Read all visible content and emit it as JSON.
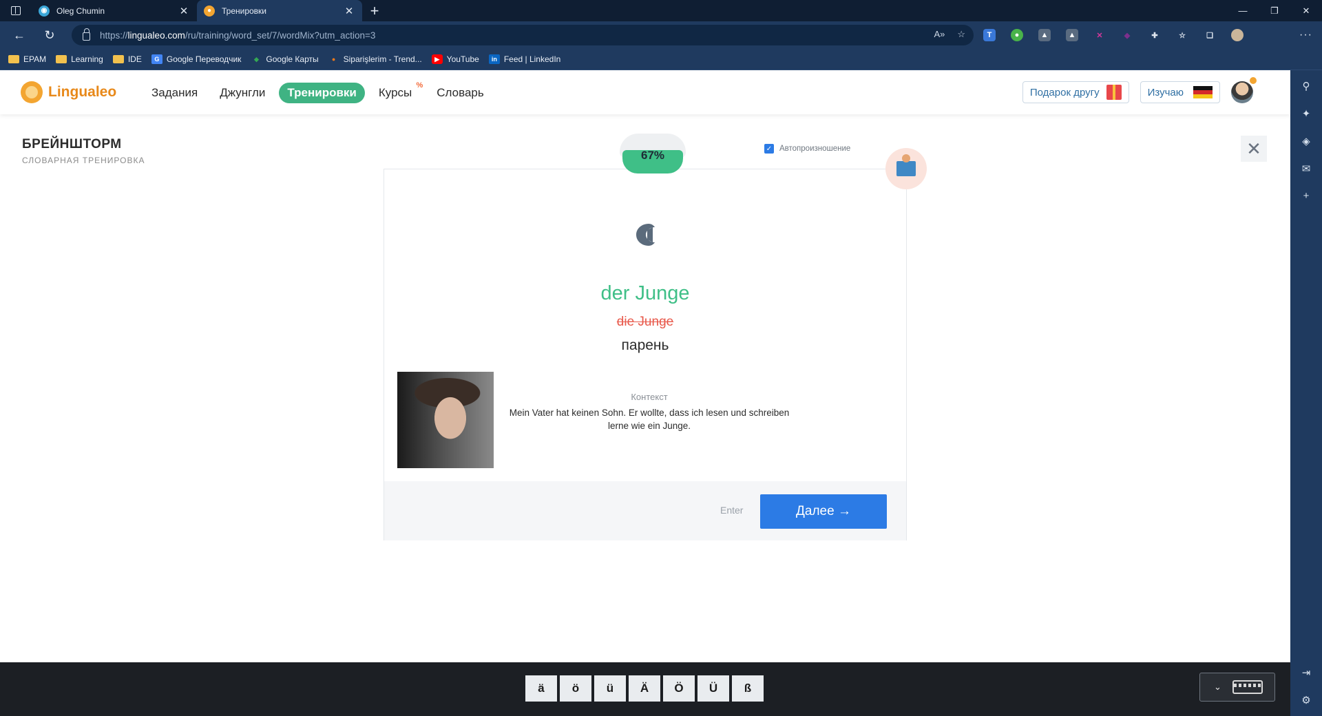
{
  "browser": {
    "tabs": [
      {
        "title": "Oleg Chumin",
        "active": false,
        "favicon": "globe-icon",
        "favicon_color": "#3aa6d8"
      },
      {
        "title": "Тренировки",
        "active": true,
        "favicon": "lingualeo-icon",
        "favicon_color": "#f3a531"
      }
    ],
    "url_prefix": "https://",
    "url_host": "lingualeo.com",
    "url_path": "/ru/training/word_set/7/wordMix?utm_action=3",
    "bookmarks": [
      {
        "label": "EPAM",
        "icon": "folder-icon"
      },
      {
        "label": "Learning",
        "icon": "folder-icon"
      },
      {
        "label": "IDE",
        "icon": "folder-icon"
      },
      {
        "label": "Google Переводчик",
        "icon": "google-translate-icon"
      },
      {
        "label": "Google Карты",
        "icon": "google-maps-icon"
      },
      {
        "label": "Siparişlerim - Trend...",
        "icon": "trendyol-icon"
      },
      {
        "label": "YouTube",
        "icon": "youtube-icon"
      },
      {
        "label": "Feed | LinkedIn",
        "icon": "linkedin-icon"
      }
    ]
  },
  "site": {
    "brand": "Lingualeo",
    "nav": [
      {
        "label": "Задания",
        "active": false,
        "badge": ""
      },
      {
        "label": "Джунгли",
        "active": false,
        "badge": ""
      },
      {
        "label": "Тренировки",
        "active": true,
        "badge": ""
      },
      {
        "label": "Курсы",
        "active": false,
        "badge": "%"
      },
      {
        "label": "Словарь",
        "active": false,
        "badge": ""
      }
    ],
    "gift_button": "Подарок другу",
    "learning_button": "Изучаю",
    "accent_color": "#3fb383",
    "primary_color": "#2c7be5"
  },
  "training": {
    "title": "БРЕЙНШТОРМ",
    "subtitle": "СЛОВАРНАЯ ТРЕНИРОВКА",
    "progress": "67%",
    "progress_value": 0.67,
    "autoplay_label": "Автопроизношение",
    "autoplay_checked": true,
    "correct_word": "der Junge",
    "wrong_answer": "die Junge",
    "translation": "парень",
    "context_label": "Контекст",
    "context_text": "Mein Vater hat keinen Sohn. Er wollte, dass ich lesen und schreiben lerne wie ein Junge.",
    "enter_hint": "Enter",
    "next_button": "Далее →"
  },
  "keyboard": {
    "keys": [
      "ä",
      "ö",
      "ü",
      "Ä",
      "Ö",
      "Ü",
      "ß"
    ]
  }
}
